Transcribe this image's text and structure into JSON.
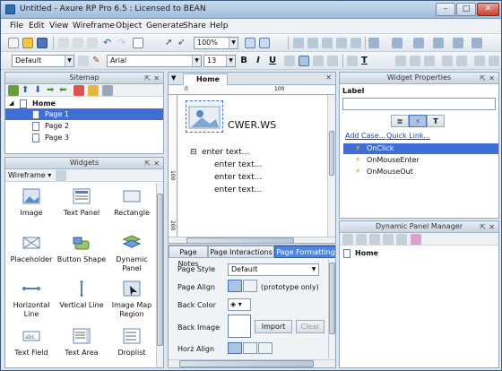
{
  "window": {
    "title": "Untitled - Axure RP Pro 6.5 : Licensed to BEAN"
  },
  "menu": [
    "File",
    "Edit",
    "View",
    "Wireframe",
    "Object",
    "Generate",
    "Share",
    "Help"
  ],
  "toolbar": {
    "zoom": "100%",
    "style": "Default",
    "font": "Arial",
    "size": "13",
    "bold": "B",
    "italic": "I",
    "underline": "U"
  },
  "sitemap": {
    "title": "Sitemap",
    "root": "Home",
    "pages": [
      "Page 1",
      "Page 2",
      "Page 3"
    ]
  },
  "widgets": {
    "title": "Widgets",
    "library": "Wireframe",
    "items": [
      {
        "label": "Image",
        "icon": "image-icon"
      },
      {
        "label": "Text Panel",
        "icon": "text-panel-icon"
      },
      {
        "label": "Rectangle",
        "icon": "rectangle-icon"
      },
      {
        "label": "Placeholder",
        "icon": "placeholder-icon"
      },
      {
        "label": "Button Shape",
        "icon": "button-shape-icon"
      },
      {
        "label": "Dynamic Panel",
        "icon": "dynamic-panel-icon"
      },
      {
        "label": "Horizontal Line",
        "icon": "horizontal-line-icon"
      },
      {
        "label": "Vertical Line",
        "icon": "vertical-line-icon"
      },
      {
        "label": "Image Map Region",
        "icon": "image-map-region-icon"
      },
      {
        "label": "Text Field",
        "icon": "text-field-icon"
      },
      {
        "label": "Text Area",
        "icon": "text-area-icon"
      },
      {
        "label": "Droplist",
        "icon": "droplist-icon"
      }
    ]
  },
  "canvas": {
    "tab": "Home",
    "ruler_top": [
      "0",
      "100"
    ],
    "ruler_left": [
      "100",
      "200"
    ],
    "caption": "CWER.WS",
    "bullets": [
      "enter text...",
      "enter text...",
      "enter text...",
      "enter text..."
    ]
  },
  "bottom_tabs": [
    "Page Notes",
    "Page Interactions",
    "Page Formatting"
  ],
  "formatting": {
    "page_style_label": "Page Style",
    "page_style_value": "Default",
    "page_align_label": "Page Align",
    "page_align_note": "(prototype only)",
    "back_color_label": "Back Color",
    "back_image_label": "Back Image",
    "import_label": "Import",
    "clear_label": "Clear",
    "horz_align_label": "Horz Align"
  },
  "widget_props": {
    "title": "Widget Properties",
    "label_heading": "Label",
    "add_case": "Add Case...",
    "quick_link": "Quick Link...",
    "tab_icons": [
      "list-icon",
      "interactions-icon",
      "text-icon"
    ],
    "tab_text": "T",
    "events": [
      "OnClick",
      "OnMouseEnter",
      "OnMouseOut"
    ]
  },
  "dpm": {
    "title": "Dynamic Panel Manager",
    "root": "Home"
  },
  "colors": {
    "accent": "#3f6fd6",
    "selected": "#3f6fd6",
    "link": "#1a3fb0"
  }
}
